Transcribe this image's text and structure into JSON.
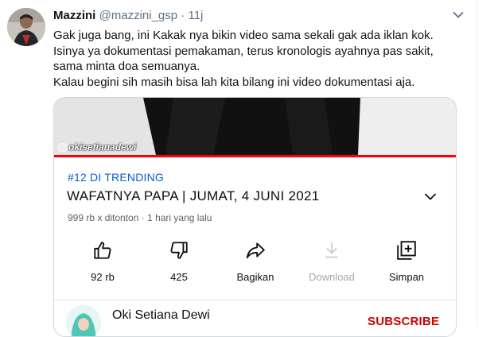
{
  "tweet": {
    "author_name": "Mazzini",
    "handle": "@mazzini_gsp",
    "separator": "·",
    "time": "11j",
    "text_lines": [
      "Gak juga bang, ini Kakak nya bikin video sama sekali gak ada iklan kok.",
      "Isinya ya dokumentasi pemakaman, terus kronologis ayahnya pas sakit,",
      "sama minta doa semuanya.",
      "Kalau begini sih masih bisa lah kita bilang ini video dokumentasi aja."
    ]
  },
  "video": {
    "watermark": "okisetianadewi",
    "trending": "#12 DI TRENDING",
    "title": "WAFATNYA PAPA | JUMAT, 4 JUNI 2021",
    "meta": "999 rb x ditonton · 1 hari yang lalu",
    "actions": [
      {
        "label": "92 rb",
        "icon": "thumbs-up-icon"
      },
      {
        "label": "425",
        "icon": "thumbs-down-icon"
      },
      {
        "label": "Bagikan",
        "icon": "share-icon"
      },
      {
        "label": "Download",
        "icon": "download-icon"
      },
      {
        "label": "Simpan",
        "icon": "save-playlist-icon"
      }
    ]
  },
  "channel": {
    "name": "Oki Setiana Dewi",
    "subscribe_label": "SUBSCRIBE"
  },
  "colors": {
    "link_blue": "#065fd4",
    "youtube_red": "#ff0000",
    "subscribe_red": "#cc0000",
    "secondary_text": "#5b7083"
  }
}
